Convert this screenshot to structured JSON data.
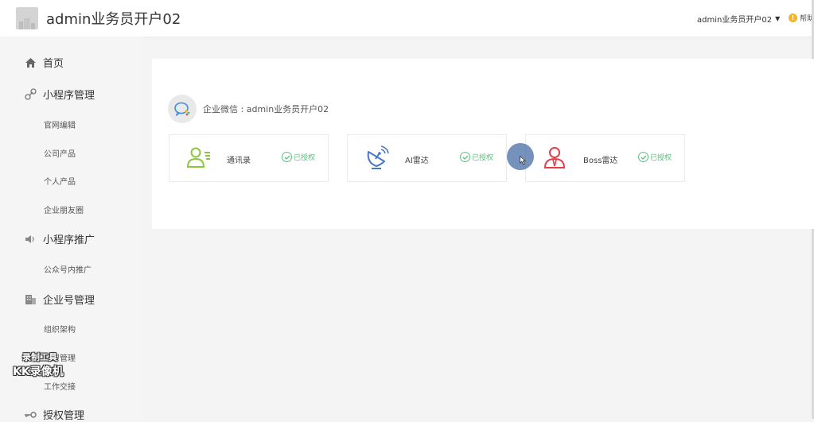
{
  "header": {
    "app_title": "admin业务员开户02",
    "user_name": "admin业务员开户02",
    "help_label": "帮助"
  },
  "sidebar": {
    "home": "首页",
    "mini_program_mgmt": "小程序管理",
    "mini_program_items": [
      "官网编辑",
      "公司产品",
      "个人产品",
      "企业朋友圈"
    ],
    "mini_program_promo": "小程序推广",
    "promo_items": [
      "公众号内推广"
    ],
    "enterprise_mgmt": "企业号管理",
    "enterprise_items": [
      "组织架构",
      "权限管理",
      "工作交接"
    ],
    "auth_mgmt": "授权管理"
  },
  "content": {
    "wechat_label": "企业微信 : admin业务员开户02",
    "cards": [
      {
        "name": "通讯录",
        "status": "已授权",
        "icon": "contacts-icon",
        "color": "#8cc63f"
      },
      {
        "name": "AI雷达",
        "status": "已授权",
        "icon": "radar-icon",
        "color": "#4a78c2"
      },
      {
        "name": "Boss雷达",
        "status": "已授权",
        "icon": "boss-icon",
        "color": "#e0404a"
      }
    ]
  },
  "watermark": {
    "line1": "录制工具",
    "line2": "KK录像机"
  }
}
